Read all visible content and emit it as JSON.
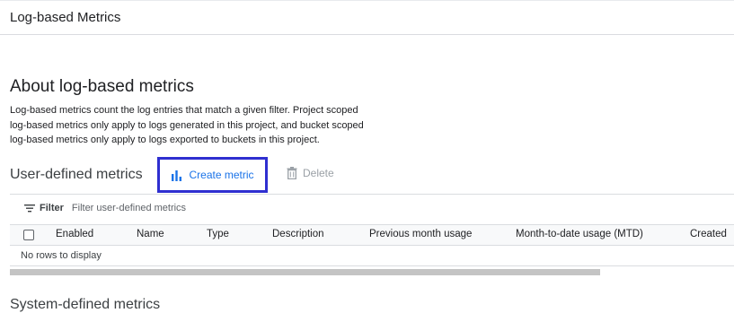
{
  "header": {
    "title": "Log-based Metrics"
  },
  "about": {
    "heading": "About log-based metrics",
    "line1": "Log-based metrics count the log entries that match a given filter. Project scoped",
    "line2": "log-based metrics only apply to logs generated in this project, and bucket scoped",
    "line3": "log-based metrics only apply to logs exported to buckets in this project."
  },
  "user_metrics": {
    "title": "User-defined metrics",
    "create_label": "Create metric",
    "create_icon": "bar-chart-icon",
    "delete_label": "Delete",
    "delete_icon": "trash-icon",
    "filter_label": "Filter",
    "filter_icon": "filter-list-icon",
    "filter_placeholder": "Filter user-defined metrics",
    "columns": [
      "Enabled",
      "Name",
      "Type",
      "Description",
      "Previous month usage",
      "Month-to-date usage (MTD)",
      "Created"
    ],
    "empty_text": "No rows to display"
  },
  "system_metrics": {
    "title": "System-defined metrics"
  },
  "colors": {
    "accent": "#1a73e8",
    "highlight_border": "#2f2fd0",
    "disabled": "#9aa0a6"
  }
}
